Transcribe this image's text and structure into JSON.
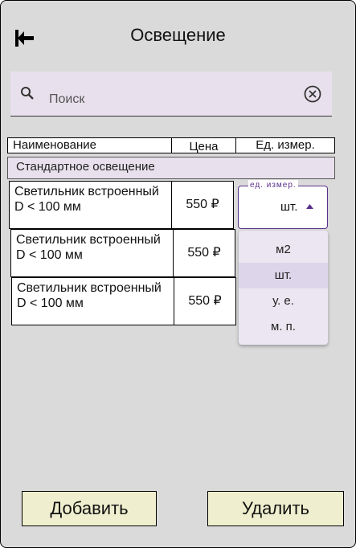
{
  "header": {
    "title": "Освещение",
    "back_icon": "back-arrow-icon"
  },
  "search": {
    "placeholder": "Поиск",
    "value": "",
    "search_icon": "search-icon",
    "clear_icon": "clear-icon"
  },
  "table": {
    "columns": [
      "Наименование",
      "Цена",
      "Ед. измер."
    ],
    "section": "Стандартное освещение",
    "rows": [
      {
        "name_line1": "Светильник встроенный",
        "name_line2": "D < 100 мм",
        "price": "550 ₽"
      },
      {
        "name_line1": "Светильник встроенный",
        "name_line2": "D < 100 мм",
        "price": "550 ₽"
      },
      {
        "name_line1": "Светильник встроенный",
        "name_line2": "D < 100 мм",
        "price": "550 ₽"
      }
    ]
  },
  "unit_select": {
    "label": "ед. измер.",
    "value": "шт.",
    "options": [
      "м2",
      "шт.",
      "у. е.",
      "м. п."
    ],
    "accent": "#5b2f8a"
  },
  "actions": {
    "add_label": "Добавить",
    "delete_label": "Удалить"
  }
}
